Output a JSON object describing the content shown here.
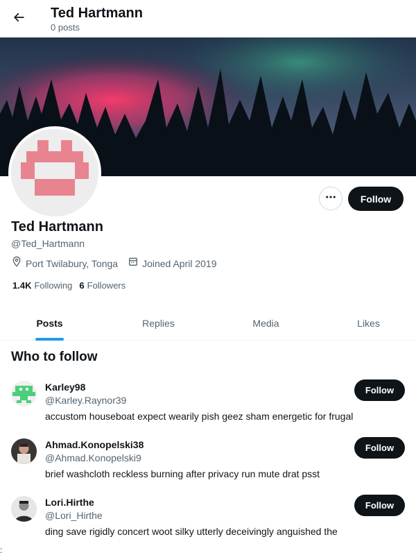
{
  "header": {
    "title": "Ted Hartmann",
    "post_count": "0 posts"
  },
  "profile": {
    "name": "Ted Hartmann",
    "handle": "@Ted_Hartmann",
    "location": "Port Twilabury, Tonga",
    "joined": "Joined April 2019",
    "following_count": "1.4K",
    "following_label": "Following",
    "followers_count": "6",
    "followers_label": "Followers",
    "follow_label": "Follow",
    "more_label": "…"
  },
  "tabs": [
    {
      "label": "Posts",
      "active": true
    },
    {
      "label": "Replies",
      "active": false
    },
    {
      "label": "Media",
      "active": false
    },
    {
      "label": "Likes",
      "active": false
    }
  ],
  "who_to_follow": {
    "title": "Who to follow",
    "items": [
      {
        "name": "Karley98",
        "handle": "@Karley.Raynor39",
        "bio": "accustom houseboat expect wearily pish geez sham energetic for frugal",
        "follow_label": "Follow"
      },
      {
        "name": "Ahmad.Konopelski38",
        "handle": "@Ahmad.Konopelski9",
        "bio": "brief washcloth reckless burning after privacy run mute drat psst",
        "follow_label": "Follow"
      },
      {
        "name": "Lori.Hirthe",
        "handle": "@Lori_Hirthe",
        "bio": "ding save rigidly concert woot silky utterly deceivingly anguished the",
        "follow_label": "Follow"
      }
    ]
  },
  "edge_mark": ":",
  "colors": {
    "accent": "#1d9bf0",
    "button_dark": "#0f1419",
    "muted_text": "#536471",
    "avatar_pink": "#e8848f",
    "identicon_green": "#4ccf7a"
  },
  "icons": {
    "back": "arrow-left-icon",
    "location": "location-pin-icon",
    "calendar": "calendar-icon",
    "more": "more-dots-icon"
  }
}
